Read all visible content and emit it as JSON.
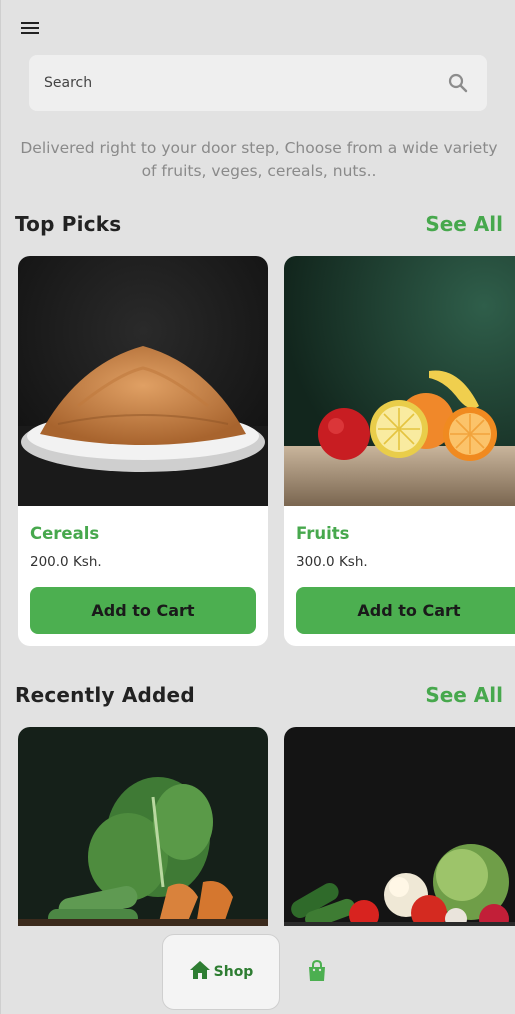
{
  "header": {
    "menu_icon": "hamburger-menu-icon"
  },
  "search": {
    "placeholder": "Search",
    "icon": "search-icon"
  },
  "tagline": "Delivered right to your door step, Choose from a wide variety of fruits, veges, cereals, nuts..",
  "top_picks": {
    "title": "Top Picks",
    "see_all": "See All",
    "items": [
      {
        "name": "Cereals",
        "price": "200.0 Ksh.",
        "button": "Add to Cart"
      },
      {
        "name": "Fruits",
        "price": "300.0 Ksh.",
        "button": "Add to Cart"
      }
    ]
  },
  "recently_added": {
    "title": "Recently Added",
    "see_all": "See All"
  },
  "bottom_nav": {
    "shop_label": "Shop",
    "shop_icon": "home-icon",
    "cart_icon": "shopping-bag-icon",
    "active_color": "#2e7d32",
    "inactive_color": "#4caf50"
  },
  "colors": {
    "accent": "#47a84d",
    "button": "#4caf50",
    "background": "#e2e2e2"
  }
}
